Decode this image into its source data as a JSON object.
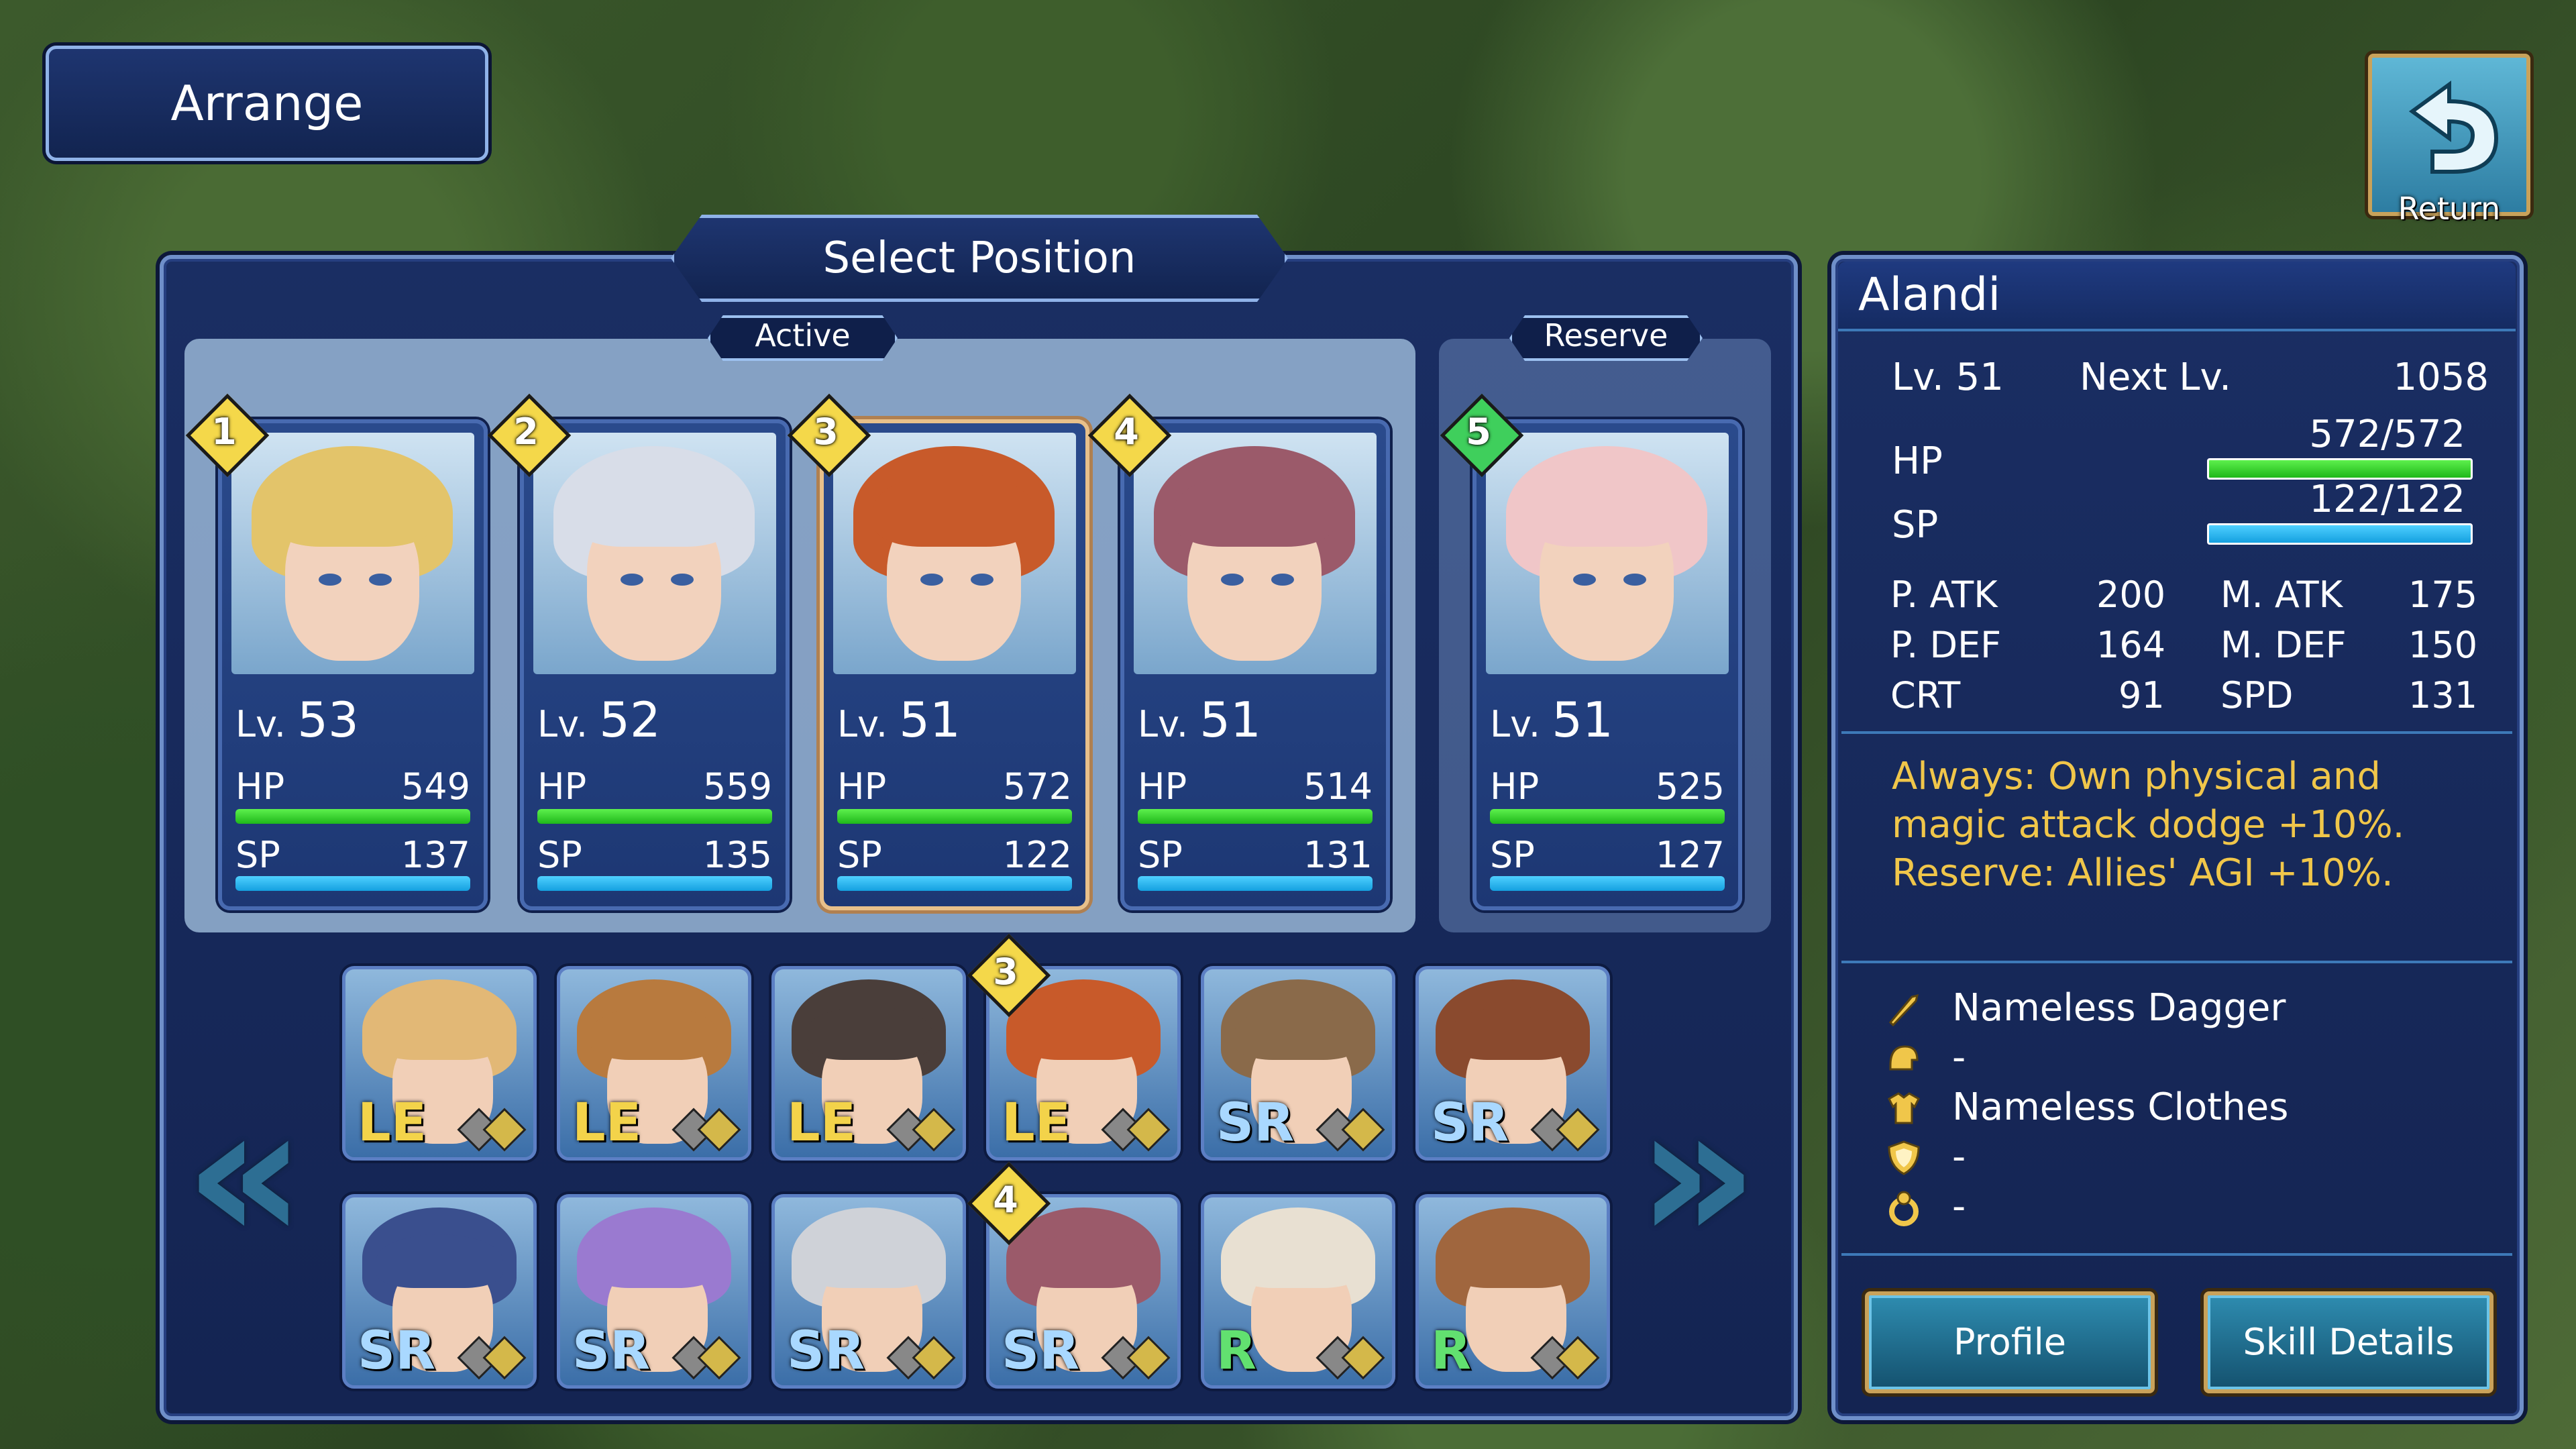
{
  "header": {
    "title": "Arrange",
    "return_label": "Return"
  },
  "select_panel": {
    "title": "Select Position",
    "active_label": "Active",
    "reserve_label": "Reserve"
  },
  "party": [
    {
      "slot": "1",
      "lv_prefix": "Lv.",
      "level": "53",
      "hp_label": "HP",
      "hp": "549",
      "sp_label": "SP",
      "sp": "137",
      "hair": "#e3c46a"
    },
    {
      "slot": "2",
      "lv_prefix": "Lv.",
      "level": "52",
      "hp_label": "HP",
      "hp": "559",
      "sp_label": "SP",
      "sp": "135",
      "hair": "#d8dde8"
    },
    {
      "slot": "3",
      "lv_prefix": "Lv.",
      "level": "51",
      "hp_label": "HP",
      "hp": "572",
      "sp_label": "SP",
      "sp": "122",
      "hair": "#c85a2a"
    },
    {
      "slot": "4",
      "lv_prefix": "Lv.",
      "level": "51",
      "hp_label": "HP",
      "hp": "514",
      "sp_label": "SP",
      "sp": "131",
      "hair": "#9b5a6a"
    },
    {
      "slot": "5",
      "lv_prefix": "Lv.",
      "level": "51",
      "hp_label": "HP",
      "hp": "525",
      "sp_label": "SP",
      "sp": "127",
      "hair": "#f0c6c8"
    }
  ],
  "roster": [
    {
      "rarity": "LE",
      "badge": "",
      "hair": "#e2b876"
    },
    {
      "rarity": "LE",
      "badge": "",
      "hair": "#b87a3e"
    },
    {
      "rarity": "LE",
      "badge": "",
      "hair": "#4a3e3a"
    },
    {
      "rarity": "LE",
      "badge": "3",
      "hair": "#c85a2a"
    },
    {
      "rarity": "SR",
      "badge": "",
      "hair": "#8a6a4a"
    },
    {
      "rarity": "SR",
      "badge": "",
      "hair": "#8a4a2e"
    },
    {
      "rarity": "SR",
      "badge": "",
      "hair": "#3a4f8e"
    },
    {
      "rarity": "SR",
      "badge": "",
      "hair": "#9a7ad0"
    },
    {
      "rarity": "SR",
      "badge": "",
      "hair": "#cfd2d8"
    },
    {
      "rarity": "SR",
      "badge": "4",
      "hair": "#9b5a6a"
    },
    {
      "rarity": "R",
      "badge": "",
      "hair": "#e8e0d2"
    },
    {
      "rarity": "R",
      "badge": "",
      "hair": "#a0663e"
    }
  ],
  "detail": {
    "name": "Alandi",
    "lv": "Lv. 51",
    "next_lv_label": "Next Lv.",
    "next_lv": "1058",
    "hp_label": "HP",
    "hp": "572/572",
    "sp_label": "SP",
    "sp": "122/122",
    "stats": {
      "patk_label": "P. ATK",
      "patk": "200",
      "matk_label": "M. ATK",
      "matk": "175",
      "pdef_label": "P. DEF",
      "pdef": "164",
      "mdef_label": "M. DEF",
      "mdef": "150",
      "crt_label": "CRT",
      "crt": "91",
      "spd_label": "SPD",
      "spd": "131"
    },
    "skill_lines": [
      "Always: Own physical and",
      "magic attack dodge +10%.",
      "Reserve: Allies' AGI +10%."
    ],
    "equipment": [
      {
        "icon": "dagger-icon",
        "label": "Nameless Dagger"
      },
      {
        "icon": "helmet-icon",
        "label": "-"
      },
      {
        "icon": "armor-icon",
        "label": "Nameless Clothes"
      },
      {
        "icon": "shield-icon",
        "label": "-"
      },
      {
        "icon": "accessory-icon",
        "label": "-"
      }
    ],
    "profile_button": "Profile",
    "skill_button": "Skill Details"
  },
  "colors": {
    "panel": "#1a2e63",
    "hp_bar": "#2fd42a",
    "sp_bar": "#1ab0f0",
    "skill_text": "#f0c64a"
  }
}
